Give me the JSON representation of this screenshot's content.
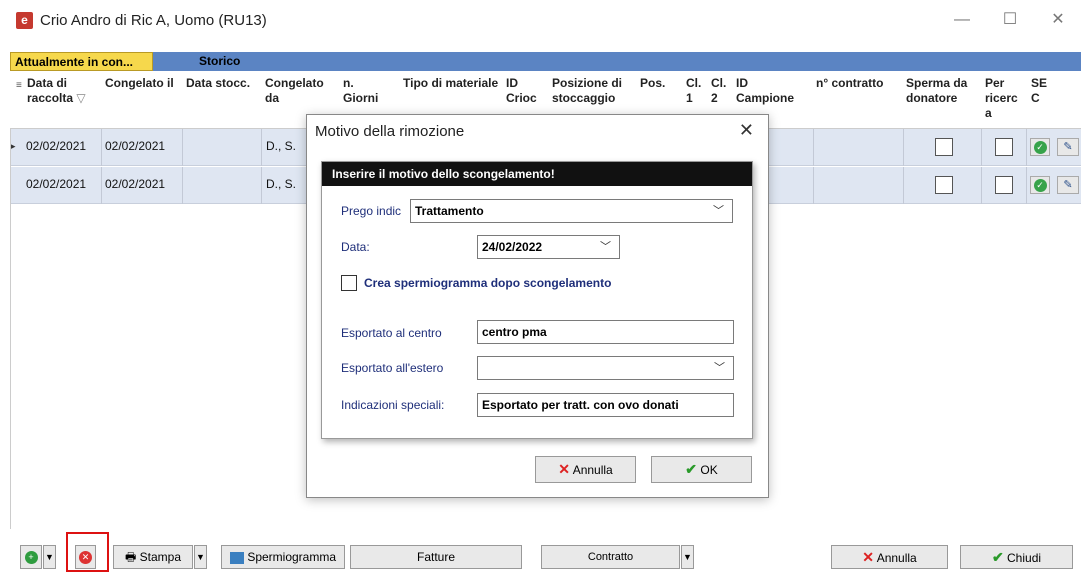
{
  "window": {
    "title": "Crio Andro di Ric A, Uomo (RU13)",
    "minimize": "—",
    "maximize": "☐",
    "close": "✕"
  },
  "tabs": [
    {
      "label": "Attualmente in con...",
      "active": true
    },
    {
      "label": "Storico",
      "active": false
    }
  ],
  "columns": {
    "data_raccolta": "Data di raccolta",
    "filter_glyph": "▽",
    "congelato_il": "Congelato il",
    "data_stocc": "Data stocc.",
    "congelato_da": "Congelato da",
    "n_giorni": "n. Giorni",
    "tipo_materiale": "Tipo di materiale",
    "id_crioc": "ID Crioc",
    "posizione": "Posizione di stoccaggio",
    "pos": "Pos.",
    "cl1": "Cl. 1",
    "cl2": "Cl. 2",
    "id_campione": "ID Campione",
    "n_contratto": "n° contratto",
    "sperma_donatore": "Sperma da donatore",
    "per_ricerca": "Per ricerc a",
    "sec": "SE C"
  },
  "rows": [
    {
      "data_raccolta": "02/02/2021",
      "congelato_il": "02/02/2021",
      "congelato_da": "D., S."
    },
    {
      "data_raccolta": "02/02/2021",
      "congelato_il": "02/02/2021",
      "congelato_da": "D., S."
    }
  ],
  "dialog": {
    "title": "Motivo della rimozione",
    "close": "✕",
    "panel_heading": "Inserire il motivo dello scongelamento!",
    "prego_label": "Prego indic",
    "prego_value": "Trattamento",
    "data_label": "Data:",
    "data_value": "24/02/2022",
    "checkbox_label": "Crea spermiogramma dopo scongelamento",
    "esportato_centro_label": "Esportato al centro",
    "esportato_centro_value": "centro pma",
    "esportato_estero_label": "Esportato all'estero",
    "esportato_estero_value": "",
    "indicazioni_label": "Indicazioni speciali:",
    "indicazioni_value": "Esportato per tratt. con ovo donati",
    "annulla": "Annulla",
    "ok": "OK"
  },
  "toolbar": {
    "stampa": "Stampa",
    "spermiogramma": "Spermiogramma",
    "fatture": "Fatture",
    "contratto": "Contratto",
    "annulla": "Annulla",
    "chiudi": "Chiudi"
  },
  "colors": {
    "tab_bar": "#5b84c3",
    "active_tab": "#f6d84c",
    "row_bg": "#dfe6f2",
    "label_blue": "#1f2f7a",
    "highlight_red": "#dd1111"
  }
}
